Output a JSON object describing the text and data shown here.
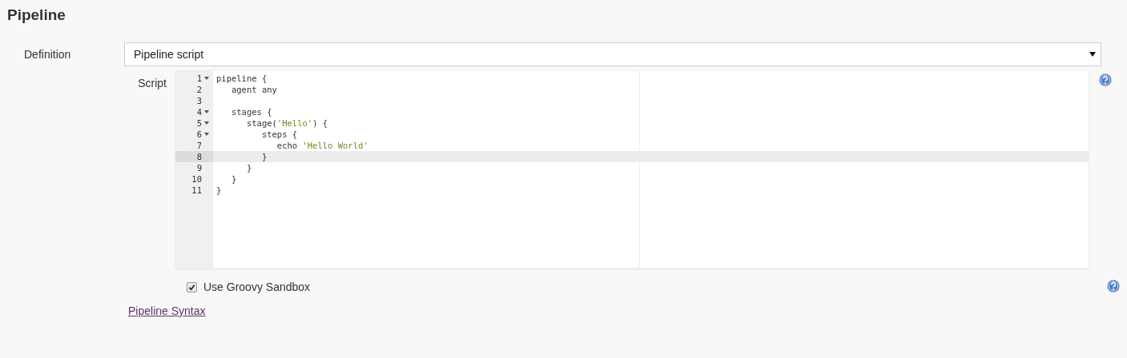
{
  "section_title": "Pipeline",
  "definition": {
    "label": "Definition",
    "value": "Pipeline script"
  },
  "script": {
    "label": "Script",
    "lines": [
      {
        "number": "1",
        "foldable": true,
        "active": false,
        "parts": [
          {
            "kind": "plain",
            "text": "pipeline {"
          }
        ]
      },
      {
        "number": "2",
        "foldable": false,
        "active": false,
        "parts": [
          {
            "kind": "plain",
            "text": "   agent any"
          }
        ]
      },
      {
        "number": "3",
        "foldable": false,
        "active": false
      },
      {
        "number": "4",
        "foldable": true,
        "active": false,
        "parts": [
          {
            "kind": "plain",
            "text": "   stages {"
          }
        ]
      },
      {
        "number": "5",
        "foldable": true,
        "active": false,
        "parts": [
          {
            "kind": "plain",
            "text": "      stage("
          },
          {
            "kind": "string",
            "text": "'Hello'"
          },
          {
            "kind": "plain",
            "text": ") {"
          }
        ]
      },
      {
        "number": "6",
        "foldable": true,
        "active": false,
        "parts": [
          {
            "kind": "plain",
            "text": "         steps {"
          }
        ]
      },
      {
        "number": "7",
        "foldable": false,
        "active": false,
        "parts": [
          {
            "kind": "plain",
            "text": "            echo "
          },
          {
            "kind": "string",
            "text": "'Hello World'"
          }
        ]
      },
      {
        "number": "8",
        "foldable": false,
        "active": true,
        "parts": [
          {
            "kind": "plain",
            "text": "         }"
          }
        ]
      },
      {
        "number": "9",
        "foldable": false,
        "active": false,
        "parts": [
          {
            "kind": "plain",
            "text": "      }"
          }
        ]
      },
      {
        "number": "10",
        "foldable": false,
        "active": false,
        "parts": [
          {
            "kind": "plain",
            "text": "   }"
          }
        ]
      },
      {
        "number": "11",
        "foldable": false,
        "active": false,
        "parts": [
          {
            "kind": "plain",
            "text": "}"
          }
        ]
      }
    ]
  },
  "sandbox": {
    "label": "Use Groovy Sandbox",
    "checked": true
  },
  "syntax_link": "Pipeline Syntax"
}
